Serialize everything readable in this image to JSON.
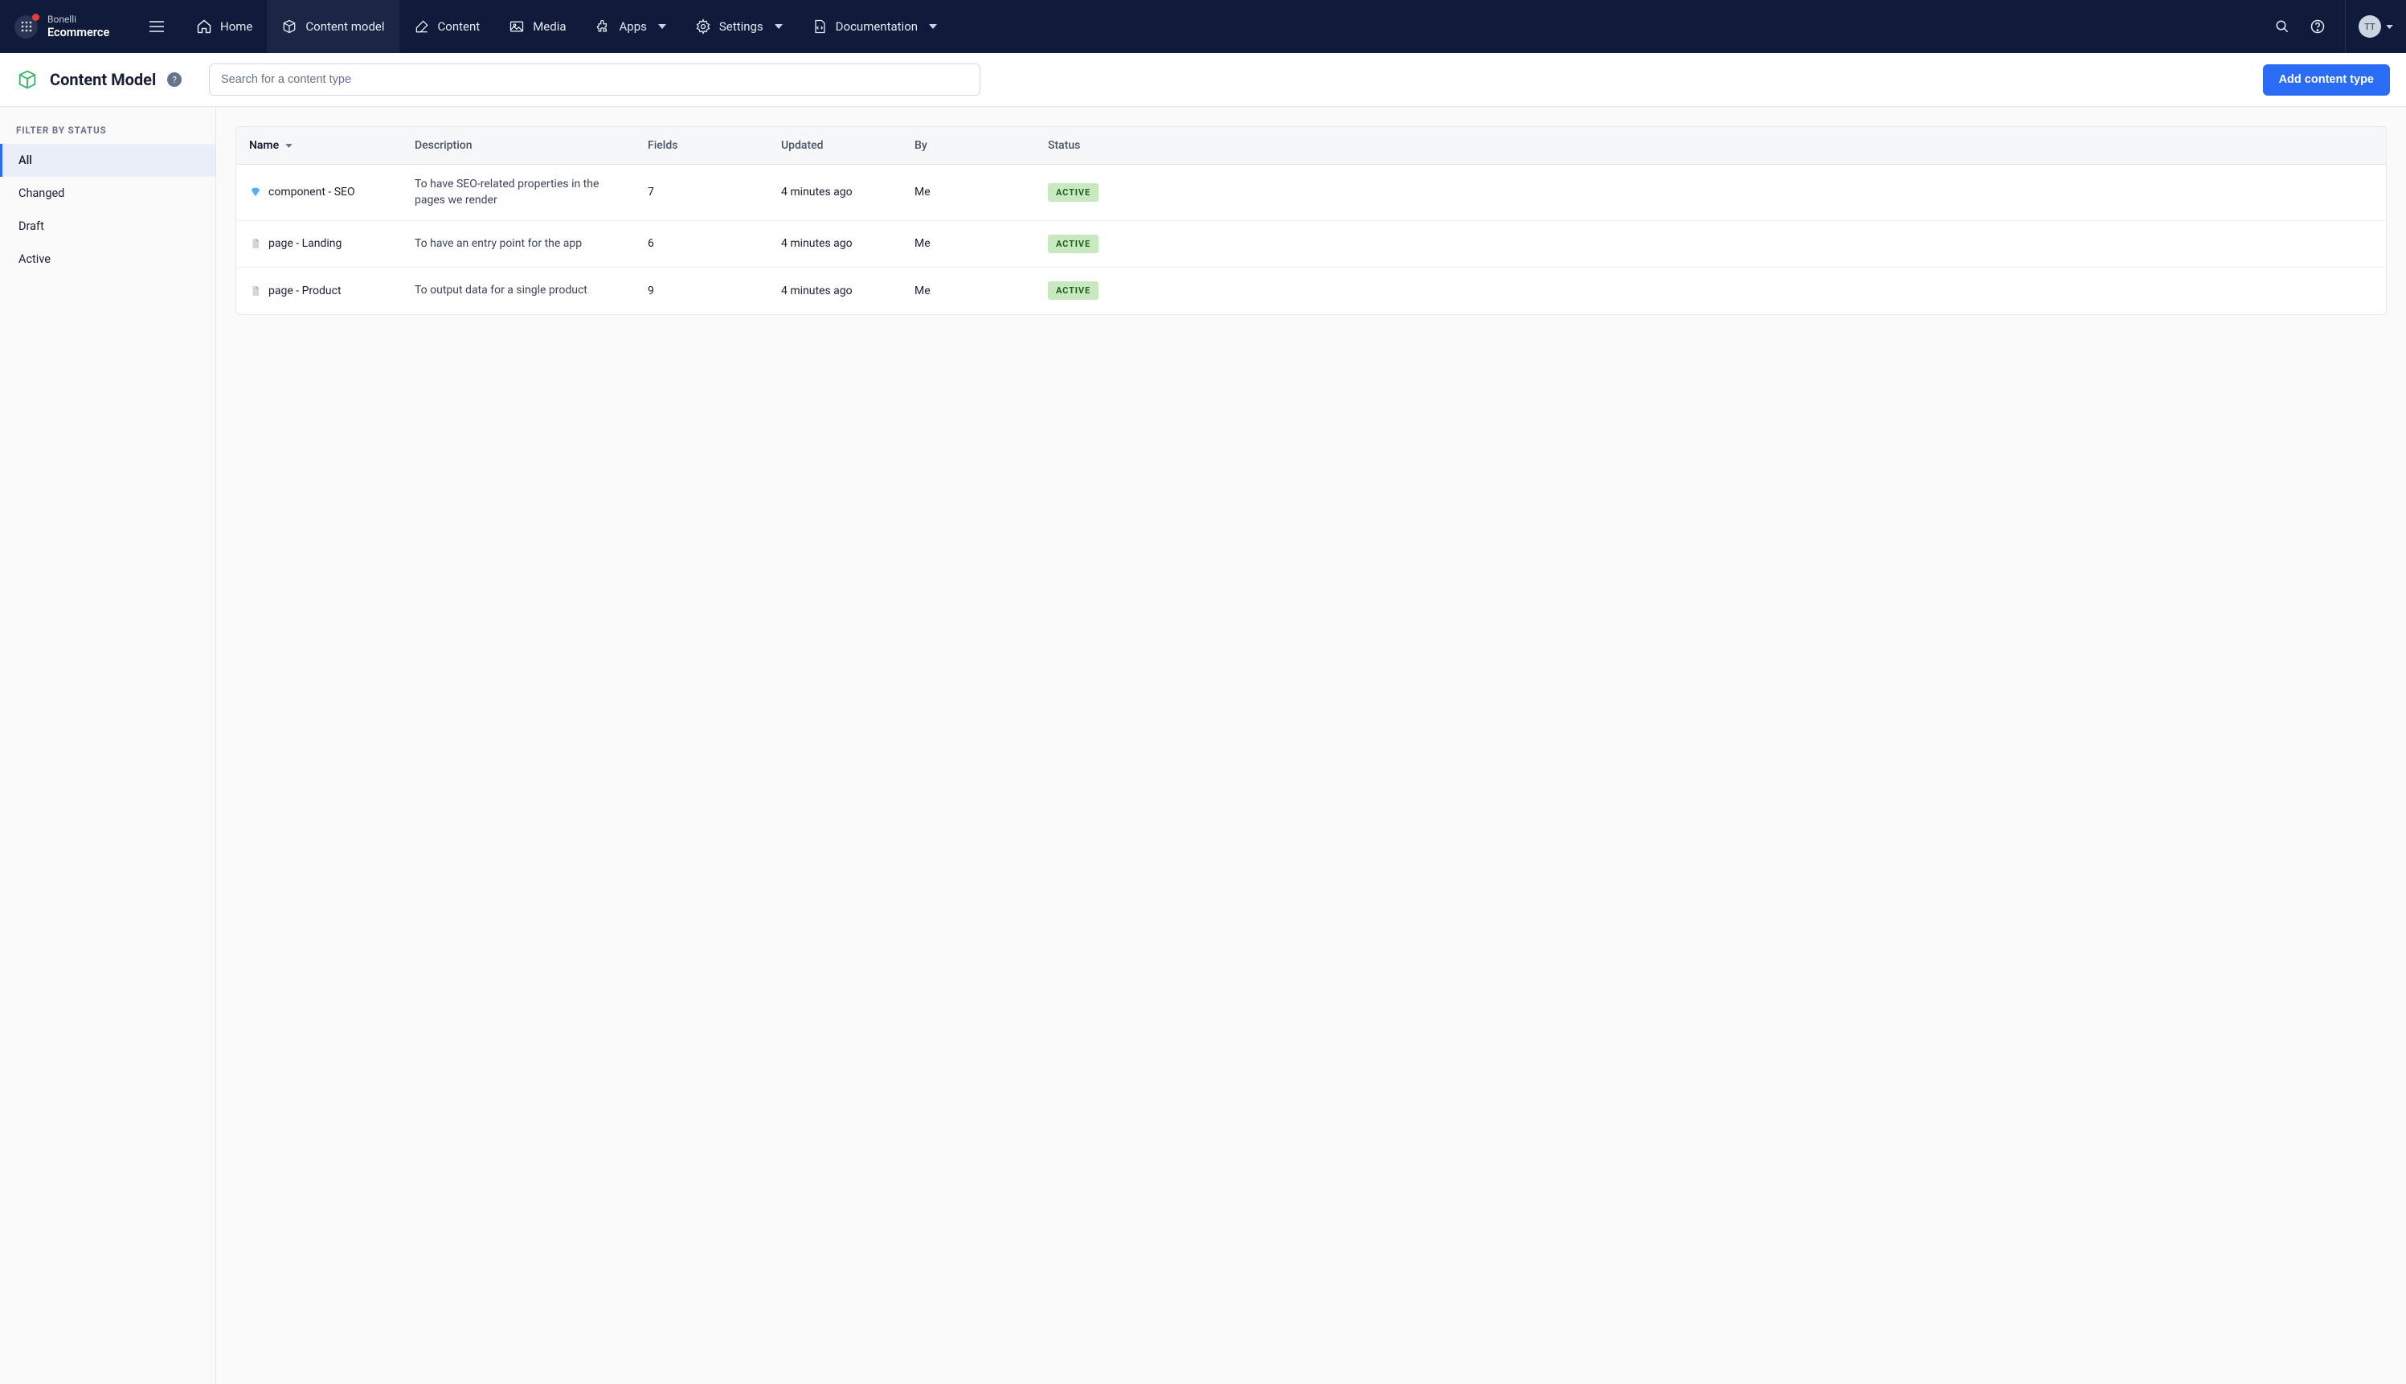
{
  "header": {
    "org": "Bonelli",
    "space": "Ecommerce",
    "nav": [
      {
        "label": "Home",
        "icon": "home"
      },
      {
        "label": "Content model",
        "icon": "box",
        "active": true
      },
      {
        "label": "Content",
        "icon": "edit"
      },
      {
        "label": "Media",
        "icon": "image"
      },
      {
        "label": "Apps",
        "icon": "puzzle",
        "caret": true
      },
      {
        "label": "Settings",
        "icon": "gear",
        "caret": true
      },
      {
        "label": "Documentation",
        "icon": "code-file",
        "caret": true
      }
    ],
    "avatar_initials": "TT"
  },
  "page": {
    "title": "Content Model",
    "search_placeholder": "Search for a content type",
    "add_button": "Add content type"
  },
  "sidebar": {
    "heading": "Filter by status",
    "filters": [
      {
        "label": "All",
        "active": true
      },
      {
        "label": "Changed"
      },
      {
        "label": "Draft"
      },
      {
        "label": "Active"
      }
    ]
  },
  "table": {
    "columns": {
      "name": "Name",
      "description": "Description",
      "fields": "Fields",
      "updated": "Updated",
      "by": "By",
      "status": "Status"
    },
    "rows": [
      {
        "icon": "diamond",
        "name": "component - SEO",
        "description": "To have SEO-related properties in the pages we render",
        "fields": "7",
        "updated": "4 minutes ago",
        "by": "Me",
        "status": "Active"
      },
      {
        "icon": "page",
        "name": "page - Landing",
        "description": "To have an entry point for the app",
        "fields": "6",
        "updated": "4 minutes ago",
        "by": "Me",
        "status": "Active"
      },
      {
        "icon": "page",
        "name": "page - Product",
        "description": "To output data for a single product",
        "fields": "9",
        "updated": "4 minutes ago",
        "by": "Me",
        "status": "Active"
      }
    ]
  }
}
